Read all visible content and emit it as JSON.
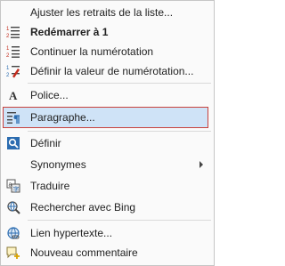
{
  "menu": {
    "items": [
      {
        "label": "Ajuster les retraits de la liste...",
        "icon": "none"
      },
      {
        "label": "Redémarrer à 1",
        "icon": "restart-numbering-icon"
      },
      {
        "label": "Continuer la numérotation",
        "icon": "continue-numbering-icon"
      },
      {
        "label": "Définir la valeur de numérotation...",
        "icon": "set-numbering-value-icon"
      },
      {
        "label": "Police...",
        "icon": "font-icon"
      },
      {
        "label": "Paragraphe...",
        "icon": "paragraph-icon",
        "highlighted": true
      },
      {
        "label": "Définir",
        "icon": "define-icon"
      },
      {
        "label": "Synonymes",
        "icon": "none",
        "has_submenu": true
      },
      {
        "label": "Traduire",
        "icon": "translate-icon"
      },
      {
        "label": "Rechercher avec Bing",
        "icon": "search-bing-icon"
      },
      {
        "label": "Lien hypertexte...",
        "icon": "hyperlink-icon"
      },
      {
        "label": "Nouveau commentaire",
        "icon": "new-comment-icon"
      }
    ]
  },
  "colors": {
    "highlight_fill": "#cfe3f7",
    "highlight_border": "#c8413c",
    "icon_red": "#c42b1c",
    "icon_blue": "#2b6cb0"
  }
}
